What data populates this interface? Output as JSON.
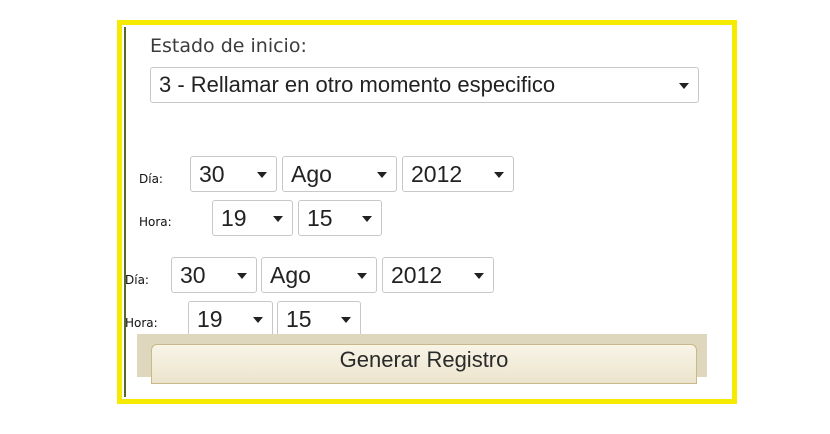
{
  "estado": {
    "label": "Estado de inicio:",
    "selected": "3 - Rellamar en otro momento especifico"
  },
  "schedule_1": {
    "dia_label": "Día:",
    "hora_label": "Hora:",
    "day": "30",
    "month": "Ago",
    "year": "2012",
    "hour": "19",
    "minute": "15"
  },
  "schedule_2": {
    "dia_label": "Día:",
    "hora_label": "Hora:",
    "day": "30",
    "month": "Ago",
    "year": "2012",
    "hour": "19",
    "minute": "15"
  },
  "actions": {
    "generate_label": "Generar Registro"
  },
  "colors": {
    "frame_border": "#f5ea00",
    "button_bar": "#ded6bd"
  }
}
